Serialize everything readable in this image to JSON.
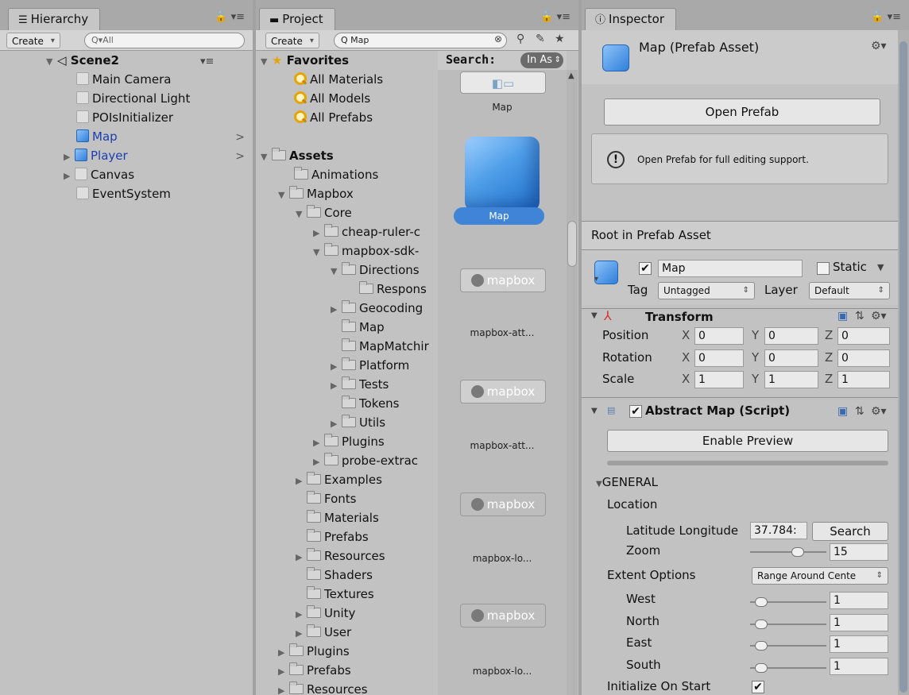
{
  "hierarchy": {
    "tab": "Hierarchy",
    "create": "Create",
    "search_placeholder": "Q▾All",
    "scene": "Scene2",
    "items": [
      {
        "label": "Main Camera",
        "kind": "gray"
      },
      {
        "label": "Directional Light",
        "kind": "gray"
      },
      {
        "label": "POIsInitializer",
        "kind": "gray"
      },
      {
        "label": "Map",
        "kind": "blue"
      },
      {
        "label": "Player",
        "kind": "blue"
      },
      {
        "label": "Canvas",
        "kind": "gray"
      },
      {
        "label": "EventSystem",
        "kind": "gray"
      }
    ]
  },
  "project": {
    "tab": "Project",
    "create": "Create",
    "search_value": "Q Map",
    "favorites": "Favorites",
    "fav_items": [
      "All Materials",
      "All Models",
      "All Prefabs"
    ],
    "assets": "Assets",
    "tree": [
      "Animations",
      "Mapbox",
      "Core",
      "cheap-ruler-c",
      "mapbox-sdk-",
      "Directions",
      "Respons",
      "Geocoding",
      "Map",
      "MapMatchir",
      "Platform",
      "Tests",
      "Tokens",
      "Utils",
      "Plugins",
      "probe-extrac",
      "Examples",
      "Fonts",
      "Materials",
      "Prefabs",
      "Resources",
      "Shaders",
      "Textures",
      "Unity",
      "User",
      "Plugins",
      "Prefabs",
      "Resources"
    ],
    "search_label": "Search:",
    "in_assets": "In As",
    "tiles": [
      {
        "label": "Map"
      },
      {
        "label": "Map"
      },
      {
        "label": "mapbox-att..."
      },
      {
        "label": "mapbox-att..."
      },
      {
        "label": "mapbox-lo..."
      },
      {
        "label": "mapbox-lo..."
      }
    ],
    "logo_text": "mapbox"
  },
  "inspector": {
    "tab": "Inspector",
    "title": "Map (Prefab Asset)",
    "open_prefab": "Open Prefab",
    "notice": "Open Prefab for full editing support.",
    "root_label": "Root in Prefab Asset",
    "name": "Map",
    "static": "Static",
    "tag_label": "Tag",
    "tag_value": "Untagged",
    "layer_label": "Layer",
    "layer_value": "Default",
    "transform": "Transform",
    "position": "Position",
    "rotation": "Rotation",
    "scale": "Scale",
    "pos": {
      "x": "0",
      "y": "0",
      "z": "0"
    },
    "rot": {
      "x": "0",
      "y": "0",
      "z": "0"
    },
    "scl": {
      "x": "1",
      "y": "1",
      "z": "1"
    },
    "axis_x": "X",
    "axis_y": "Y",
    "axis_z": "Z",
    "script": "Abstract Map (Script)",
    "enable_preview": "Enable Preview",
    "general": "GENERAL",
    "location": "Location",
    "latlon_label": "Latitude Longitude",
    "latlon_value": "37.784:",
    "search_btn": "Search",
    "zoom_label": "Zoom",
    "zoom_value": "15",
    "extent_label": "Extent Options",
    "extent_value": "Range Around Cente",
    "west": "West",
    "north": "North",
    "east": "East",
    "south": "South",
    "west_v": "1",
    "north_v": "1",
    "east_v": "1",
    "south_v": "1",
    "init_label": "Initialize On Start",
    "check": "✔"
  }
}
